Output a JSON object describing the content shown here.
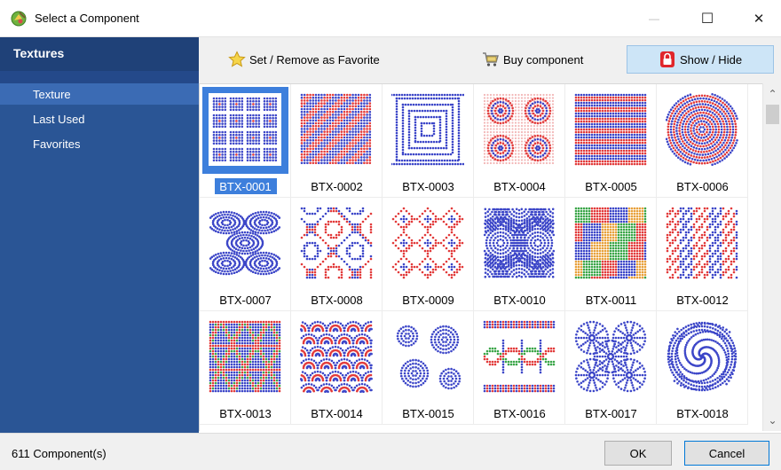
{
  "window": {
    "title": "Select a Component",
    "minimize_glyph": "—",
    "maximize_glyph": "☐",
    "close_glyph": "✕"
  },
  "sidebar": {
    "header": "Textures",
    "items": [
      {
        "label": "Texture",
        "selected": true
      },
      {
        "label": "Last Used",
        "selected": false
      },
      {
        "label": "Favorites",
        "selected": false
      }
    ]
  },
  "toolbar": {
    "favorite_label": "Set / Remove as Favorite",
    "buy_label": "Buy component",
    "showhide_label": "Show / Hide",
    "favorite_icon": "star-icon",
    "buy_icon": "cart-icon",
    "showhide_icon": "lock-icon"
  },
  "components": [
    {
      "label": "BTX-0001",
      "pattern": "squares",
      "selected": true
    },
    {
      "label": "BTX-0002",
      "pattern": "diagonal"
    },
    {
      "label": "BTX-0003",
      "pattern": "maze"
    },
    {
      "label": "BTX-0004",
      "pattern": "medallions"
    },
    {
      "label": "BTX-0005",
      "pattern": "stripes"
    },
    {
      "label": "BTX-0006",
      "pattern": "concentric"
    },
    {
      "label": "BTX-0007",
      "pattern": "ovals"
    },
    {
      "label": "BTX-0008",
      "pattern": "swirls"
    },
    {
      "label": "BTX-0009",
      "pattern": "diamonds"
    },
    {
      "label": "BTX-0010",
      "pattern": "arcs"
    },
    {
      "label": "BTX-0011",
      "pattern": "hexagons"
    },
    {
      "label": "BTX-0012",
      "pattern": "columns"
    },
    {
      "label": "BTX-0013",
      "pattern": "triangles"
    },
    {
      "label": "BTX-0014",
      "pattern": "scales"
    },
    {
      "label": "BTX-0015",
      "pattern": "circles"
    },
    {
      "label": "BTX-0016",
      "pattern": "waves"
    },
    {
      "label": "BTX-0017",
      "pattern": "fans"
    },
    {
      "label": "BTX-0018",
      "pattern": "spiral"
    }
  ],
  "scrollbar": {
    "up_glyph": "⌃",
    "down_glyph": "⌄"
  },
  "status": {
    "count_text": "611 Component(s)"
  },
  "buttons": {
    "ok_label": "OK",
    "cancel_label": "Cancel"
  },
  "colors": {
    "red": "#e23a3a",
    "blue": "#3c46c8",
    "green": "#3aa648",
    "orange": "#e8a03a",
    "sidebar": "#2a5595",
    "accent": "#3d7fdc"
  }
}
